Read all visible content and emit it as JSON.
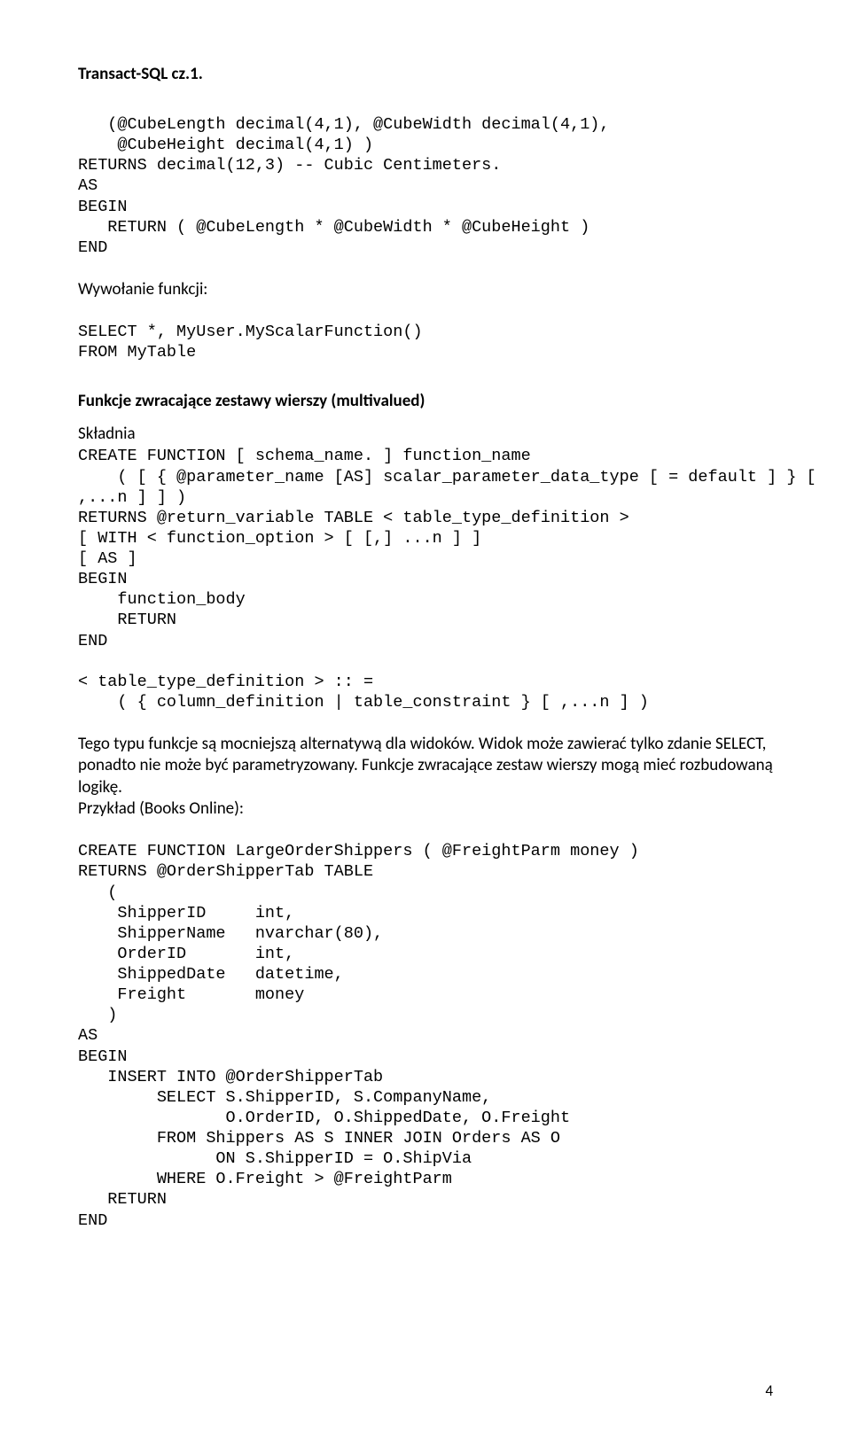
{
  "header": {
    "title": "Transact-SQL cz.1."
  },
  "code1": "   (@CubeLength decimal(4,1), @CubeWidth decimal(4,1),\n    @CubeHeight decimal(4,1) )\nRETURNS decimal(12,3) -- Cubic Centimeters.\nAS\nBEGIN\n   RETURN ( @CubeLength * @CubeWidth * @CubeHeight )\nEND",
  "label1": "Wywołanie funkcji:",
  "code2": "SELECT *, MyUser.MyScalarFunction()\nFROM MyTable",
  "heading2": "Funkcje zwracające zestawy wierszy (multivalued)",
  "label2": "Składnia",
  "code3": "CREATE FUNCTION [ schema_name. ] function_name\n    ( [ { @parameter_name [AS] scalar_parameter_data_type [ = default ] } [\n,...n ] ] )\nRETURNS @return_variable TABLE < table_type_definition >\n[ WITH < function_option > [ [,] ...n ] ]\n[ AS ]\nBEGIN\n    function_body\n    RETURN\nEND\n\n< table_type_definition > :: =\n    ( { column_definition | table_constraint } [ ,...n ] )",
  "para1": "Tego typu funkcje są mocniejszą alternatywą dla widoków. Widok może zawierać tylko zdanie SELECT, ponadto nie może być parametryzowany. Funkcje zwracające zestaw wierszy mogą mieć rozbudowaną logikę.",
  "label3": "Przykład (Books Online):",
  "code4": "CREATE FUNCTION LargeOrderShippers ( @FreightParm money )\nRETURNS @OrderShipperTab TABLE\n   (\n    ShipperID     int,\n    ShipperName   nvarchar(80),\n    OrderID       int,\n    ShippedDate   datetime,\n    Freight       money\n   )\nAS\nBEGIN\n   INSERT INTO @OrderShipperTab\n        SELECT S.ShipperID, S.CompanyName,\n               O.OrderID, O.ShippedDate, O.Freight\n        FROM Shippers AS S INNER JOIN Orders AS O\n              ON S.ShipperID = O.ShipVia\n        WHERE O.Freight > @FreightParm\n   RETURN\nEND",
  "pageNumber": "4"
}
